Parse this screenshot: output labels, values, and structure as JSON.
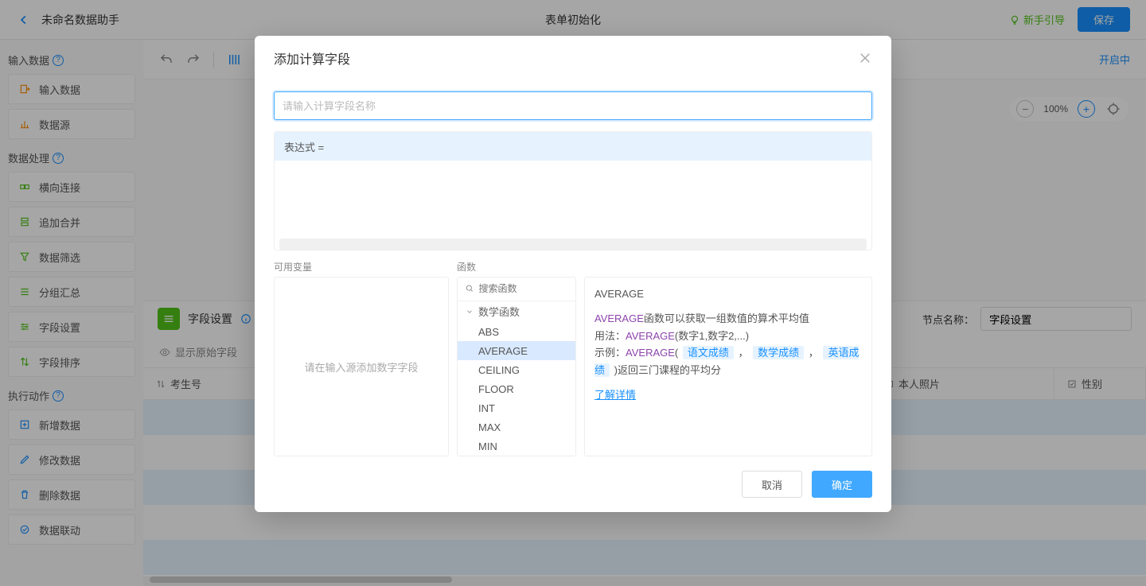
{
  "topbar": {
    "titleLeft": "未命名数据助手",
    "titleCenter": "表单初始化",
    "guide": "新手引导",
    "save": "保存"
  },
  "sidebar": {
    "sections": {
      "input": {
        "title": "输入数据"
      },
      "process": {
        "title": "数据处理"
      },
      "action": {
        "title": "执行动作"
      }
    },
    "items": {
      "inputData": "输入数据",
      "dataSource": "数据源",
      "horizontalJoin": "横向连接",
      "appendMerge": "追加合并",
      "dataFilter": "数据筛选",
      "groupAgg": "分组汇总",
      "fieldSettings": "字段设置",
      "fieldSort": "字段排序",
      "addData": "新增数据",
      "modifyData": "修改数据",
      "deleteData": "删除数据",
      "dataLink": "数据联动"
    }
  },
  "toolbar": {
    "right": "开启中"
  },
  "zoom": {
    "pct": "100%"
  },
  "settings": {
    "badgeLabel": "字段设置",
    "nodeNameLabel": "节点名称：",
    "nodeNameValue": "字段设置",
    "showOriginal": "显示原始字段",
    "columns": {
      "examNo": "考生号",
      "photo": "本人照片",
      "gender": "性别"
    }
  },
  "modal": {
    "title": "添加计算字段",
    "namePlaceholder": "请输入计算字段名称",
    "exprLabel": "表达式 =",
    "varsLabel": "可用变量",
    "funcsLabel": "函数",
    "varsEmpty": "请在输入源添加数字字段",
    "funcSearchPlaceholder": "搜索函数",
    "funcCategory": "数学函数",
    "funcs": [
      "ABS",
      "AVERAGE",
      "CEILING",
      "FLOOR",
      "INT",
      "MAX",
      "MIN"
    ],
    "selectedFunc": "AVERAGE",
    "desc": {
      "name": "AVERAGE",
      "line1_a": "AVERAGE",
      "line1_b": "函数可以获取一组数值的算术平均值",
      "line2_a": "用法：",
      "line2_b": "AVERAGE",
      "line2_c": "(数字1,数字2,...)",
      "line3_a": "示例：",
      "line3_b": "AVERAGE",
      "line3_c": "(",
      "tag1": "语文成绩",
      "comma1": "，",
      "tag2": "数学成绩",
      "comma2": "，",
      "tag3": "英语成绩",
      "line3_end": ")返回三门课程的平均分",
      "learnMore": "了解详情"
    },
    "cancel": "取消",
    "ok": "确定"
  },
  "colors": {
    "primary": "#1890ff",
    "green": "#52c41a",
    "iconOrange": "#ff8c00",
    "iconPurple": "#1890ff"
  }
}
